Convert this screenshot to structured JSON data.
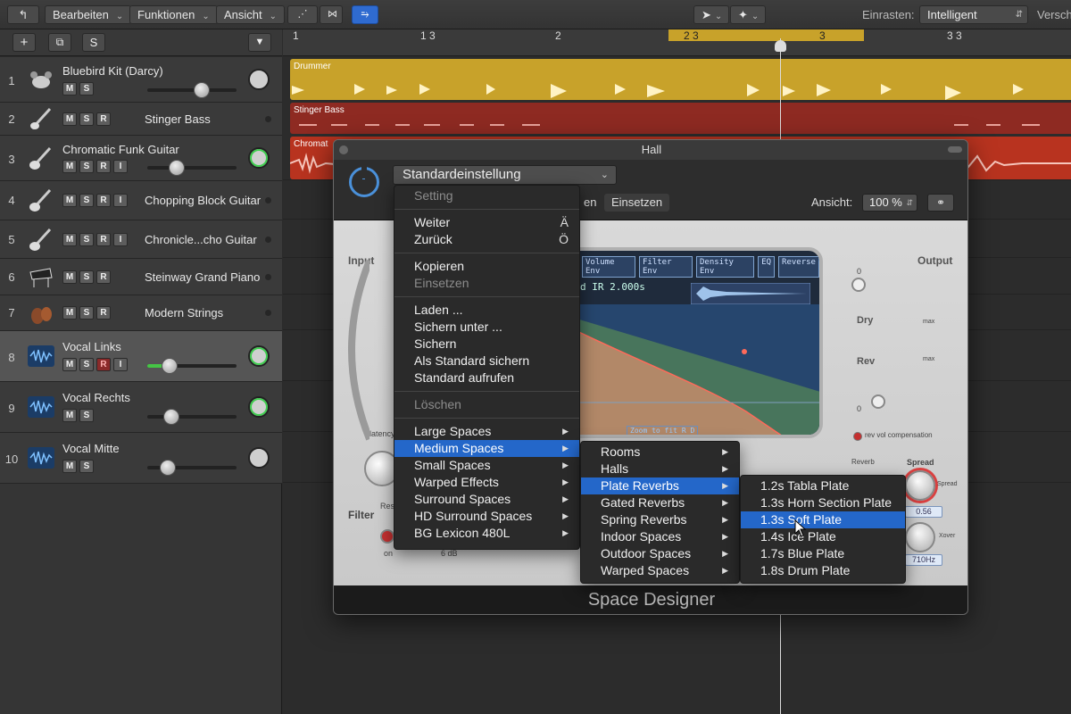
{
  "toolbar": {
    "bearbeiten": "Bearbeiten",
    "funktionen": "Funktionen",
    "ansicht": "Ansicht",
    "einrasten_label": "Einrasten:",
    "einrasten_value": "Intelligent",
    "versch_label": "Versch"
  },
  "track_toolbar": {
    "add": "+",
    "solo": "S"
  },
  "ruler": {
    "m1": "1",
    "m13": "1 3",
    "m2": "2",
    "m23": "2 3",
    "m3": "3",
    "m33": "3 3"
  },
  "tracks": [
    {
      "num": "1",
      "name": "Bluebird Kit (Darcy)"
    },
    {
      "num": "2",
      "name": "Stinger Bass"
    },
    {
      "num": "3",
      "name": "Chromatic Funk Guitar"
    },
    {
      "num": "4",
      "name": "Chopping Block Guitar"
    },
    {
      "num": "5",
      "name": "Chronicle...cho Guitar"
    },
    {
      "num": "6",
      "name": "Steinway Grand Piano"
    },
    {
      "num": "7",
      "name": "Modern Strings"
    },
    {
      "num": "8",
      "name": "Vocal Links"
    },
    {
      "num": "9",
      "name": "Vocal Rechts"
    },
    {
      "num": "10",
      "name": "Vocal Mitte"
    }
  ],
  "buttons": {
    "m": "M",
    "s": "S",
    "r": "R",
    "i": "I"
  },
  "regions": {
    "drummer": "Drummer",
    "stinger": "Stinger Bass",
    "chromatic": "Chromat"
  },
  "plugin": {
    "title": "Hall",
    "preset": "Standardeinstellung",
    "tab_partial": "en",
    "tab_einsetzen": "Einsetzen",
    "ansicht_label": "Ansicht:",
    "zoom": "100 %",
    "name": "Space Designer",
    "input": "Input",
    "output": "Output",
    "filter": "Filter",
    "latency": "latency",
    "res": "Res",
    "on": "on",
    "db6": "6 dB",
    "dry": "Dry",
    "rev": "Rev",
    "max1": "max",
    "max2": "max",
    "zero1": "0",
    "zero2": "0",
    "revvol": "rev vol compensation",
    "reverb": "Reverb",
    "spread_label": "Spread",
    "spread_knob": "Spread",
    "spread_val": "0.56",
    "xover": "Xover",
    "xover_val": "710Hz",
    "ir_label": "d IR 2.000s",
    "tab_volenv": "Volume Env",
    "tab_filterenv": "Filter Env",
    "tab_densenv": "Density Env",
    "tab_eq": "EQ",
    "tab_reverse": "Reverse",
    "zoomfit": "Zoom to fit",
    "zoom_r": "R",
    "zoom_d": "D"
  },
  "menu1": {
    "setting": "Setting",
    "weiter": "Weiter",
    "weiter_sc": "Ä",
    "zurueck": "Zurück",
    "zurueck_sc": "Ö",
    "kopieren": "Kopieren",
    "einsetzen": "Einsetzen",
    "laden": "Laden ...",
    "sichern_unter": "Sichern unter ...",
    "sichern": "Sichern",
    "als_standard": "Als Standard sichern",
    "standard_aufrufen": "Standard aufrufen",
    "loeschen": "Löschen",
    "large": "Large Spaces",
    "medium": "Medium Spaces",
    "small": "Small Spaces",
    "warped": "Warped Effects",
    "surround": "Surround Spaces",
    "hd_surround": "HD Surround Spaces",
    "bg_lexicon": "BG Lexicon 480L"
  },
  "menu2": {
    "rooms": "Rooms",
    "halls": "Halls",
    "plate": "Plate Reverbs",
    "gated": "Gated Reverbs",
    "spring": "Spring Reverbs",
    "indoor": "Indoor Spaces",
    "outdoor": "Outdoor Spaces",
    "warped": "Warped Spaces"
  },
  "menu3": {
    "p1": "1.2s Tabla Plate",
    "p2": "1.3s Horn Section Plate",
    "p3": "1.3s Soft Plate",
    "p4": "1.4s Ice Plate",
    "p5": "1.7s Blue Plate",
    "p6": "1.8s Drum Plate"
  },
  "colors": {
    "accent": "#2467c9",
    "drummer": "#c8a22a",
    "bass": "#8e2a22",
    "guitar": "#b8331f",
    "meter": "#45c545"
  }
}
